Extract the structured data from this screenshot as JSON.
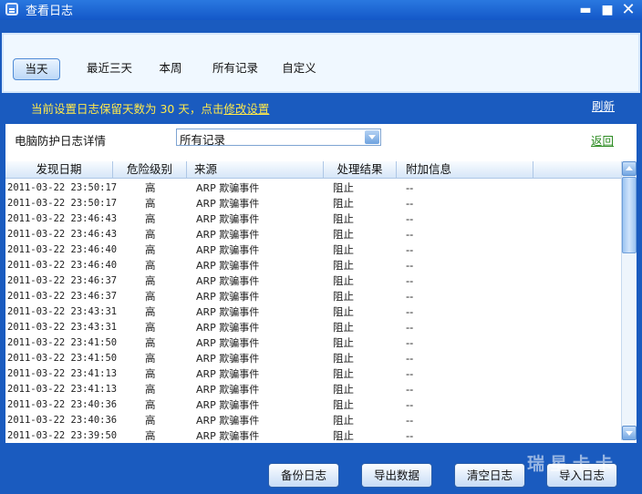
{
  "window": {
    "title": "查看日志",
    "controls": {
      "minimize": "▬",
      "maximize": "■",
      "close": "✕"
    }
  },
  "tabs": [
    {
      "label": "当天",
      "active": true
    },
    {
      "label": "最近三天",
      "active": false
    },
    {
      "label": "本周",
      "active": false
    },
    {
      "label": "所有记录",
      "active": false
    },
    {
      "label": "自定义",
      "active": false
    }
  ],
  "notice": {
    "text": "当前设置日志保留天数为 30 天，点击",
    "link": "修改设置"
  },
  "refresh_label": "刷新",
  "detail": {
    "label": "电脑防护日志详情",
    "select_value": "所有记录",
    "back_label": "返回"
  },
  "table": {
    "headers": [
      "发现日期",
      "危险级别",
      "来源",
      "处理结果",
      "附加信息"
    ],
    "rows": [
      {
        "date": "2011-03-22 23:50:17",
        "risk": "高",
        "source": "ARP 欺骗事件",
        "result": "阻止",
        "info": "--"
      },
      {
        "date": "2011-03-22 23:50:17",
        "risk": "高",
        "source": "ARP 欺骗事件",
        "result": "阻止",
        "info": "--"
      },
      {
        "date": "2011-03-22 23:46:43",
        "risk": "高",
        "source": "ARP 欺骗事件",
        "result": "阻止",
        "info": "--"
      },
      {
        "date": "2011-03-22 23:46:43",
        "risk": "高",
        "source": "ARP 欺骗事件",
        "result": "阻止",
        "info": "--"
      },
      {
        "date": "2011-03-22 23:46:40",
        "risk": "高",
        "source": "ARP 欺骗事件",
        "result": "阻止",
        "info": "--"
      },
      {
        "date": "2011-03-22 23:46:40",
        "risk": "高",
        "source": "ARP 欺骗事件",
        "result": "阻止",
        "info": "--"
      },
      {
        "date": "2011-03-22 23:46:37",
        "risk": "高",
        "source": "ARP 欺骗事件",
        "result": "阻止",
        "info": "--"
      },
      {
        "date": "2011-03-22 23:46:37",
        "risk": "高",
        "source": "ARP 欺骗事件",
        "result": "阻止",
        "info": "--"
      },
      {
        "date": "2011-03-22 23:43:31",
        "risk": "高",
        "source": "ARP 欺骗事件",
        "result": "阻止",
        "info": "--"
      },
      {
        "date": "2011-03-22 23:43:31",
        "risk": "高",
        "source": "ARP 欺骗事件",
        "result": "阻止",
        "info": "--"
      },
      {
        "date": "2011-03-22 23:41:50",
        "risk": "高",
        "source": "ARP 欺骗事件",
        "result": "阻止",
        "info": "--"
      },
      {
        "date": "2011-03-22 23:41:50",
        "risk": "高",
        "source": "ARP 欺骗事件",
        "result": "阻止",
        "info": "--"
      },
      {
        "date": "2011-03-22 23:41:13",
        "risk": "高",
        "source": "ARP 欺骗事件",
        "result": "阻止",
        "info": "--"
      },
      {
        "date": "2011-03-22 23:41:13",
        "risk": "高",
        "source": "ARP 欺骗事件",
        "result": "阻止",
        "info": "--"
      },
      {
        "date": "2011-03-22 23:40:36",
        "risk": "高",
        "source": "ARP 欺骗事件",
        "result": "阻止",
        "info": "--"
      },
      {
        "date": "2011-03-22 23:40:36",
        "risk": "高",
        "source": "ARP 欺骗事件",
        "result": "阻止",
        "info": "--"
      },
      {
        "date": "2011-03-22 23:39:50",
        "risk": "高",
        "source": "ARP 欺骗事件",
        "result": "阻止",
        "info": "--"
      }
    ]
  },
  "buttons": {
    "backup": "备份日志",
    "export": "导出数据",
    "clear": "清空日志",
    "import": "导入日志"
  },
  "watermark": "瑞星卡卡",
  "colors": {
    "window_blue": "#1a5bbf",
    "notice_yellow": "#ffe94a",
    "back_link_green": "#2a8a1f"
  }
}
